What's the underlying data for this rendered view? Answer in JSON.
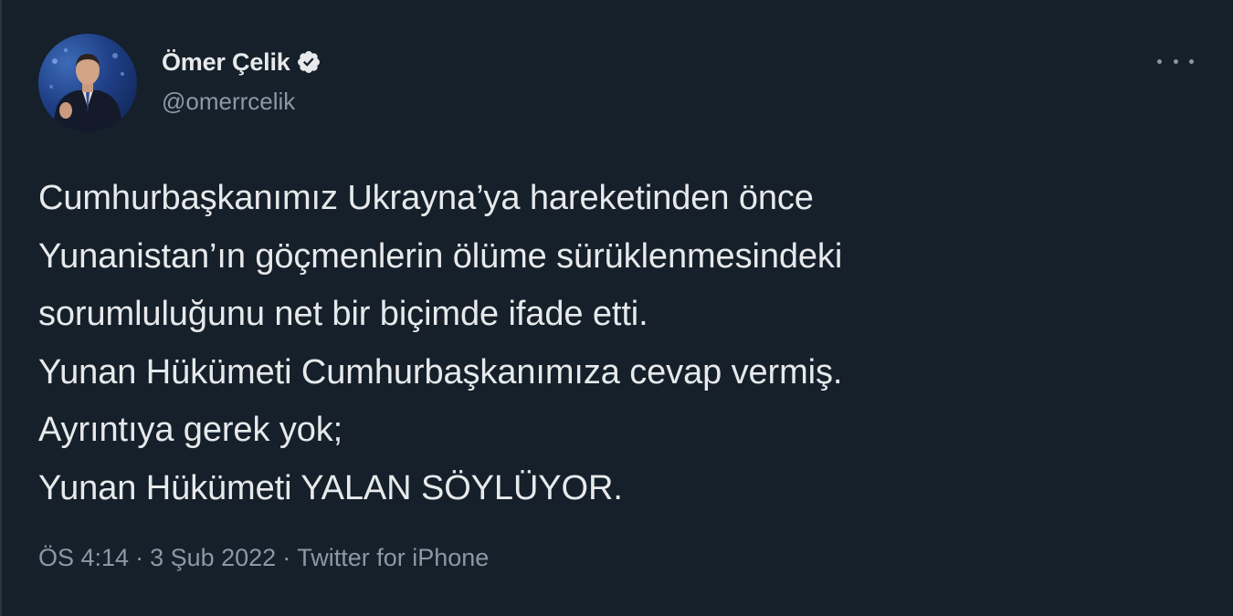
{
  "author": {
    "display_name": "Ömer Çelik",
    "handle": "@omerrcelik",
    "verified_icon": "verified-badge-icon"
  },
  "tweet": {
    "lines": [
      "Cumhurbaşkanımız Ukrayna’ya hareketinden önce",
      "Yunanistan’ın göçmenlerin ölüme sürüklenmesindeki",
      "sorumluluğunu net bir biçimde ifade etti.",
      "Yunan Hükümeti Cumhurbaşkanımıza cevap vermiş.",
      "Ayrıntıya gerek yok;",
      "Yunan Hükümeti YALAN SÖYLÜYOR."
    ]
  },
  "meta": {
    "time": "ÖS 4:14",
    "separator": "·",
    "date": "3 Şub 2022",
    "source": "Twitter for iPhone"
  },
  "colors": {
    "background": "#15202b",
    "text": "#e7e9ea",
    "secondary_text": "#8b98a5"
  }
}
